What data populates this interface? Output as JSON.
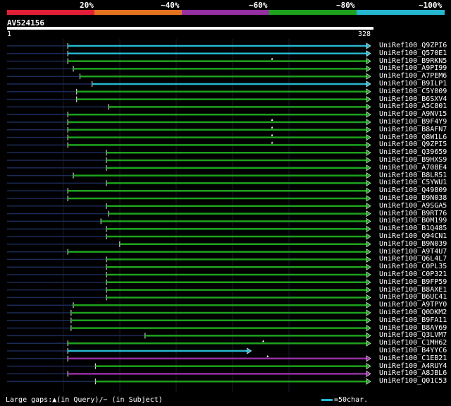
{
  "legend": {
    "labels": [
      "20%",
      "~40%",
      "~60%",
      "~80%",
      "~100%"
    ],
    "colors": [
      "#e21f36",
      "#e47320",
      "#962fa2",
      "#1da21d",
      "#25b7cf"
    ]
  },
  "query": {
    "id": "AV524156",
    "start": "1",
    "end": "328"
  },
  "footer": {
    "gaps": "Large gaps:▲(in Query)/− (in Subject)",
    "scale": "=50char."
  },
  "hits": [
    {
      "name": "UniRef100_Q9ZPI6",
      "start": 55,
      "color": "#25b7cf",
      "gap": null
    },
    {
      "name": "UniRef100_Q570E1",
      "start": 55,
      "color": "#25b7cf",
      "gap": null
    },
    {
      "name": "UniRef100_B9RKN5",
      "start": 55,
      "color": "#1da21d",
      "gap": 240
    },
    {
      "name": "UniRef100_A9PI99",
      "start": 60,
      "color": "#1da21d",
      "gap": null
    },
    {
      "name": "UniRef100_A7PEM6",
      "start": 66,
      "color": "#1da21d",
      "gap": null
    },
    {
      "name": "UniRef100_B9ILP1",
      "start": 77,
      "color": "#25b7cf",
      "gap": null
    },
    {
      "name": "UniRef100_C5Y009",
      "start": 63,
      "color": "#1da21d",
      "gap": null
    },
    {
      "name": "UniRef100_B6SXV4",
      "start": 63,
      "color": "#1da21d",
      "gap": null
    },
    {
      "name": "UniRef100_A5C801",
      "start": 92,
      "color": "#1da21d",
      "gap": null
    },
    {
      "name": "UniRef100_A9NV15",
      "start": 55,
      "color": "#1da21d",
      "gap": null
    },
    {
      "name": "UniRef100_B9F4Y9",
      "start": 55,
      "color": "#1da21d",
      "gap": 240
    },
    {
      "name": "UniRef100_B8AFN7",
      "start": 55,
      "color": "#1da21d",
      "gap": 240
    },
    {
      "name": "UniRef100_Q8W1L6",
      "start": 55,
      "color": "#1da21d",
      "gap": 240
    },
    {
      "name": "UniRef100_Q9ZPI5",
      "start": 55,
      "color": "#1da21d",
      "gap": 240
    },
    {
      "name": "UniRef100_Q39659",
      "start": 90,
      "color": "#1da21d",
      "gap": null
    },
    {
      "name": "UniRef100_B9HXS9",
      "start": 90,
      "color": "#1da21d",
      "gap": null
    },
    {
      "name": "UniRef100_A708E4",
      "start": 90,
      "color": "#1da21d",
      "gap": null
    },
    {
      "name": "UniRef100_B8LR51",
      "start": 60,
      "color": "#1da21d",
      "gap": null
    },
    {
      "name": "UniRef100_C5YWU1",
      "start": 90,
      "color": "#1da21d",
      "gap": null
    },
    {
      "name": "UniRef100_Q49809",
      "start": 55,
      "color": "#1da21d",
      "gap": null
    },
    {
      "name": "UniRef100_B9N038",
      "start": 55,
      "color": "#1da21d",
      "gap": null
    },
    {
      "name": "UniRef100_A9SGA5",
      "start": 90,
      "color": "#1da21d",
      "gap": null
    },
    {
      "name": "UniRef100_B9RT76",
      "start": 92,
      "color": "#1da21d",
      "gap": null
    },
    {
      "name": "UniRef100_B0M199",
      "start": 85,
      "color": "#1da21d",
      "gap": null
    },
    {
      "name": "UniRef100_B1Q485",
      "start": 90,
      "color": "#1da21d",
      "gap": null
    },
    {
      "name": "UniRef100_Q94CN1",
      "start": 90,
      "color": "#1da21d",
      "gap": null
    },
    {
      "name": "UniRef100_B9N039",
      "start": 102,
      "color": "#1da21d",
      "gap": null
    },
    {
      "name": "UniRef100_A9T4U7",
      "start": 55,
      "color": "#1da21d",
      "gap": null
    },
    {
      "name": "UniRef100_Q6L4L7",
      "start": 90,
      "color": "#1da21d",
      "gap": null
    },
    {
      "name": "UniRef100_C0PL35",
      "start": 90,
      "color": "#1da21d",
      "gap": null
    },
    {
      "name": "UniRef100_C0P321",
      "start": 90,
      "color": "#1da21d",
      "gap": null
    },
    {
      "name": "UniRef100_B9FP59",
      "start": 90,
      "color": "#1da21d",
      "gap": null
    },
    {
      "name": "UniRef100_B8AXE1",
      "start": 90,
      "color": "#1da21d",
      "gap": null
    },
    {
      "name": "UniRef100_B6UC41",
      "start": 90,
      "color": "#1da21d",
      "gap": null
    },
    {
      "name": "UniRef100_A9TPY0",
      "start": 60,
      "color": "#1da21d",
      "gap": null
    },
    {
      "name": "UniRef100_Q0DKM2",
      "start": 58,
      "color": "#1da21d",
      "gap": null
    },
    {
      "name": "UniRef100_B9FA11",
      "start": 58,
      "color": "#1da21d",
      "gap": null
    },
    {
      "name": "UniRef100_B8AY69",
      "start": 58,
      "color": "#1da21d",
      "gap": null
    },
    {
      "name": "UniRef100_Q3LVM7",
      "start": 125,
      "color": "#1da21d",
      "gap": null
    },
    {
      "name": "UniRef100_C1MH62",
      "start": 55,
      "color": "#1da21d",
      "gap": 232
    },
    {
      "name": "UniRef100_B4YYC6",
      "start": 55,
      "color": "#25b7cf",
      "gap": null,
      "end": 220
    },
    {
      "name": "UniRef100_C1EB21",
      "start": 55,
      "color": "#962fa2",
      "gap": 236
    },
    {
      "name": "UniRef100_A4RUY4",
      "start": 80,
      "color": "#1da21d",
      "gap": null,
      "end": 328
    },
    {
      "name": "UniRef100_A8JBL6",
      "start": 55,
      "color": "#962fa2",
      "gap": null,
      "end": 328
    },
    {
      "name": "UniRef100_Q01C53",
      "start": 80,
      "color": "#1da21d",
      "gap": null,
      "end": 328
    }
  ]
}
